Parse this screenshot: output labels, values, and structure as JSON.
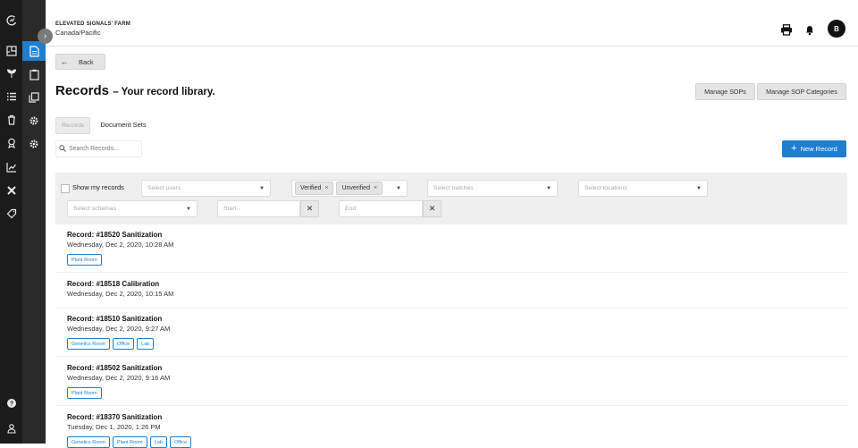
{
  "header": {
    "farm_name": "ELEVATED SIGNALS' FARM",
    "timezone": "Canada/Pacific",
    "avatar_initial": "B"
  },
  "nav": {
    "back_label": "Back"
  },
  "page": {
    "title": "Records",
    "subtitle": "– Your record library."
  },
  "actions": {
    "manage_sops": "Manage SOPs",
    "manage_sop_categories": "Manage SOP Categories",
    "new_record": "New Record"
  },
  "tabs": [
    {
      "label": "Records",
      "selected": true
    },
    {
      "label": "Document Sets",
      "selected": false
    }
  ],
  "search": {
    "placeholder": "Search Records..."
  },
  "filters": {
    "show_my_records_label": "Show my records",
    "users_placeholder": "Select users",
    "status_chips": [
      "Verified",
      "Unverified"
    ],
    "batches_placeholder": "Select batches",
    "locations_placeholder": "Select locations",
    "schemas_placeholder": "Select schemas",
    "start_placeholder": "Start",
    "end_placeholder": "End"
  },
  "records": [
    {
      "title": "Record: #18520 Sanitization",
      "date": "Wednesday, Dec 2, 2020, 10:28 AM",
      "tags": [
        "Plant Room"
      ]
    },
    {
      "title": "Record: #18518 Calibration",
      "date": "Wednesday, Dec 2, 2020, 10:15 AM",
      "tags": []
    },
    {
      "title": "Record: #18510 Sanitization",
      "date": "Wednesday, Dec 2, 2020, 9:27 AM",
      "tags": [
        "Genetics Room",
        "Office",
        "Lab"
      ]
    },
    {
      "title": "Record: #18502 Sanitization",
      "date": "Wednesday, Dec 2, 2020, 9:16 AM",
      "tags": [
        "Plant Room"
      ]
    },
    {
      "title": "Record: #18370 Sanitization",
      "date": "Tuesday, Dec 1, 2020, 1:26 PM",
      "tags": [
        "Genetics Room",
        "Plant Room",
        "Lab",
        "Office"
      ]
    }
  ],
  "colors": {
    "accent": "#1f7ed0",
    "rail_dark": "#1b1b1b",
    "rail_mid": "#2a2a2a"
  },
  "icons": {
    "rail": [
      "logo-icon",
      "floorplan-icon",
      "plant-icon",
      "list-icon",
      "trash-icon",
      "award-icon",
      "chart-icon",
      "tools-icon",
      "tag-icon",
      "help-icon",
      "user-icon"
    ],
    "rail2": [
      "document-icon",
      "clipboard-icon",
      "copy-icon",
      "gear-icon",
      "gear-icon"
    ],
    "header": [
      "printer-icon",
      "bell-icon"
    ]
  }
}
